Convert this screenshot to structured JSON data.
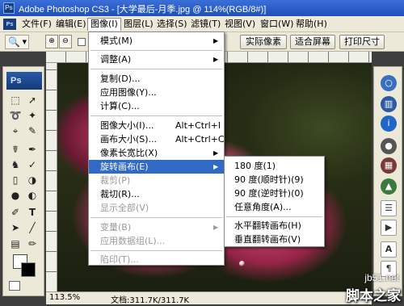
{
  "window": {
    "title": "Adobe Photoshop CS3 - [大学最后-月季.jpg @ 114%(RGB/8#)]",
    "app_icon": "Ps"
  },
  "menubar": {
    "ps_icon": "Ps",
    "items": [
      "文件(F)",
      "编辑(E)",
      "图像(I)",
      "图层(L)",
      "选择(S)",
      "滤镜(T)",
      "视图(V)",
      "窗口(W)",
      "帮助(H)"
    ]
  },
  "options": {
    "tool_icon": "zoom-tool-icon",
    "buttons": [
      "实际像素",
      "适合屏幕",
      "打印尺寸"
    ]
  },
  "toolbox": {
    "logo": "Ps",
    "tools": [
      "marquee-icon",
      "move-icon",
      "lasso-icon",
      "magic-wand-icon",
      "crop-icon",
      "eyedropper-icon",
      "healing-brush-icon",
      "brush-icon",
      "clone-stamp-icon",
      "history-brush-icon",
      "eraser-icon",
      "paint-bucket-icon",
      "blur-icon",
      "dodge-icon",
      "pen-icon",
      "type-icon",
      "path-selection-icon",
      "line-icon",
      "notes-icon",
      "eyedropper2-icon",
      "hand-icon",
      "zoom-icon"
    ]
  },
  "image_menu": {
    "items": [
      {
        "label": "模式(M)",
        "submenu": true
      },
      {
        "label": "调整(A)",
        "submenu": true
      },
      {
        "label": "复制(D)..."
      },
      {
        "label": "应用图像(Y)..."
      },
      {
        "label": "计算(C)..."
      },
      {
        "label": "图像大小(I)...",
        "shortcut": "Alt+Ctrl+I"
      },
      {
        "label": "画布大小(S)...",
        "shortcut": "Alt+Ctrl+C"
      },
      {
        "label": "像素长宽比(X)",
        "submenu": true
      },
      {
        "label": "旋转画布(E)",
        "submenu": true,
        "highlight": true
      },
      {
        "label": "裁剪(P)",
        "disabled": true
      },
      {
        "label": "裁切(R)..."
      },
      {
        "label": "显示全部(V)",
        "disabled": true
      },
      {
        "label": "变量(B)",
        "submenu": true,
        "disabled": true
      },
      {
        "label": "应用数据组(L)...",
        "disabled": true
      },
      {
        "label": "陷印(T)...",
        "disabled": true
      }
    ]
  },
  "rotate_submenu": {
    "items": [
      "180 度(1)",
      "90 度(顺时针)(9)",
      "90 度(逆时针)(0)",
      "任意角度(A)...",
      "水平翻转画布(H)",
      "垂直翻转画布(V)"
    ]
  },
  "status": {
    "zoom": "113.5%",
    "doc": "文档:311.7K/311.7K"
  },
  "watermark": {
    "url": "jb51.net",
    "name": "脚本之家"
  }
}
